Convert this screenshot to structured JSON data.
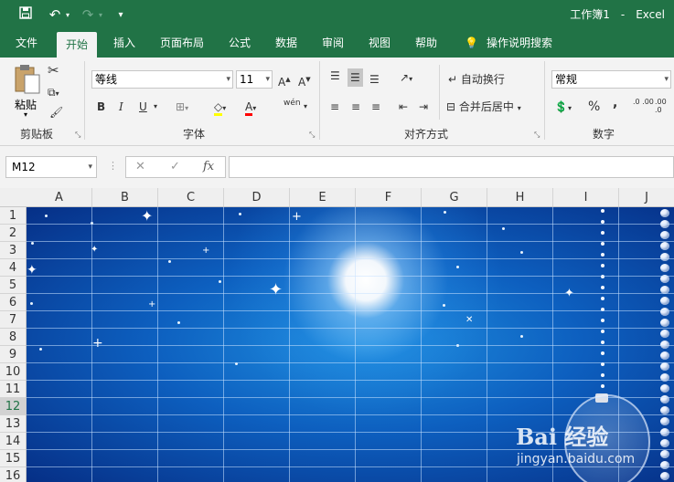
{
  "titlebar": {
    "doc_name": "工作簿1",
    "app_name": "Excel"
  },
  "tabs": [
    {
      "label": "文件"
    },
    {
      "label": "开始"
    },
    {
      "label": "插入"
    },
    {
      "label": "页面布局"
    },
    {
      "label": "公式"
    },
    {
      "label": "数据"
    },
    {
      "label": "审阅"
    },
    {
      "label": "视图"
    },
    {
      "label": "帮助"
    },
    {
      "label": "操作说明搜索"
    }
  ],
  "active_tab": "开始",
  "ribbon": {
    "clipboard": {
      "paste_label": "粘贴",
      "group_label": "剪贴板"
    },
    "font": {
      "font_name": "等线",
      "font_size": "11",
      "group_label": "字体",
      "bold": "B",
      "italic": "I",
      "underline": "U",
      "font_color_glyph": "A",
      "phonetic": "wén"
    },
    "alignment": {
      "wrap_text": "自动换行",
      "merge_center": "合并后居中",
      "group_label": "对齐方式"
    },
    "number": {
      "format": "常规",
      "percent": "%",
      "comma": ",",
      "dec_inc": ".0 .00",
      "dec_dec": ".00 .0",
      "group_label": "数字"
    }
  },
  "formula_bar": {
    "name_box": "M12",
    "cancel": "✕",
    "enter": "✓",
    "fx": "fx",
    "content": ""
  },
  "columns": [
    "A",
    "B",
    "C",
    "D",
    "E",
    "F",
    "G",
    "H",
    "I",
    "J"
  ],
  "rows": [
    "1",
    "2",
    "3",
    "4",
    "5",
    "6",
    "7",
    "8",
    "9",
    "10",
    "11",
    "12",
    "13",
    "14",
    "15",
    "16"
  ],
  "selected_row": "12",
  "watermark": {
    "brand": "Bai 经验",
    "url": "jingyan.baidu.com"
  },
  "colors": {
    "excel_green": "#217346",
    "ribbon_bg": "#f3f3f3",
    "sheet_blue": "#0d5fbf"
  }
}
